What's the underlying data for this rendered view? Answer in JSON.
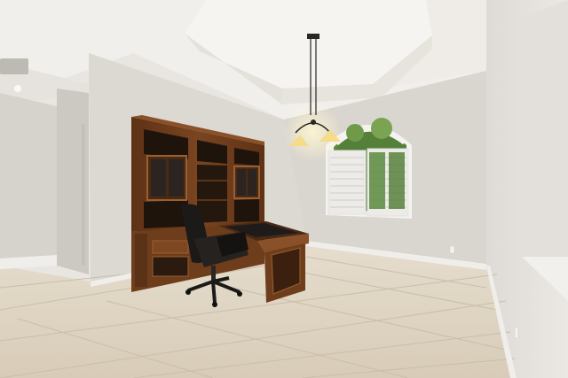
{
  "scene": {
    "description_free": true,
    "colors": {
      "wall": "#dcd8d2",
      "wall_shadow": "#c9c5bf",
      "ceiling": "#f1efeb",
      "floor_tile": "#ddd4c4",
      "floor_grout": "#c9beac",
      "wood": "#6e3d1c",
      "wood_light": "#8a5128",
      "chair": "#1c1a19",
      "foliage": "#4f7a33"
    }
  }
}
